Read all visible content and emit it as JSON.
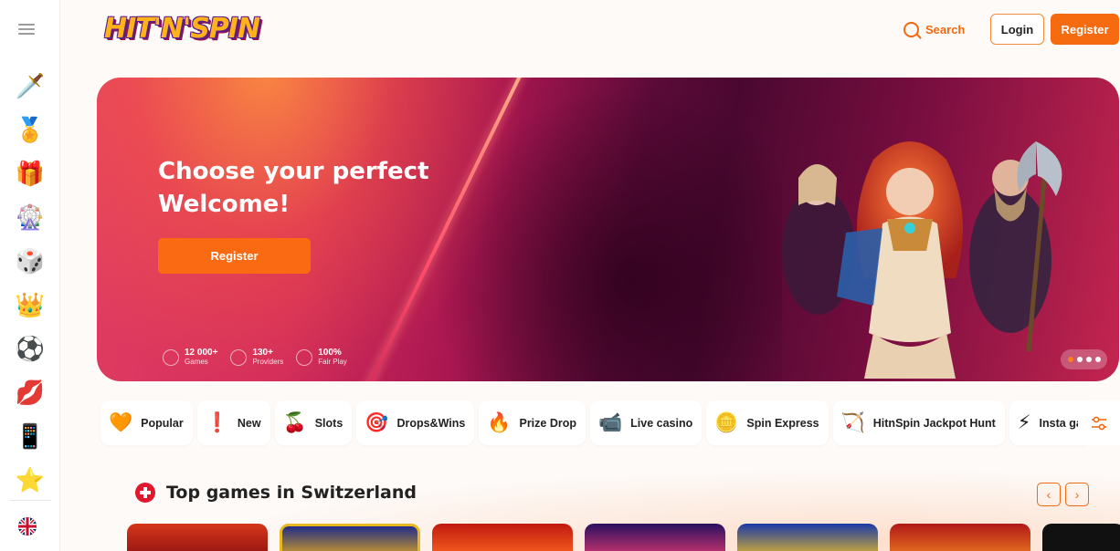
{
  "header": {
    "logo_text": "HIT'N'SPIN",
    "search_label": "Search",
    "login_label": "Login",
    "register_label": "Register"
  },
  "sidebar": {
    "items": [
      {
        "icon": "sword-icon",
        "glyph": "🗡️"
      },
      {
        "icon": "medal-icon",
        "glyph": "🏅"
      },
      {
        "icon": "gift-icon",
        "glyph": "🎁"
      },
      {
        "icon": "wheel-icon",
        "glyph": "🎡"
      },
      {
        "icon": "dice-icon",
        "glyph": "🎲"
      },
      {
        "icon": "crown-icon",
        "glyph": "👑"
      },
      {
        "icon": "football-icon",
        "glyph": "⚽"
      },
      {
        "icon": "lips-icon",
        "glyph": "💋"
      },
      {
        "icon": "phone-icon",
        "glyph": "📱"
      },
      {
        "icon": "star-icon",
        "glyph": "⭐"
      }
    ],
    "language_icon": "uk-flag-icon"
  },
  "banner": {
    "title": "Choose your perfect Welcome!",
    "register_label": "Register",
    "stats": [
      {
        "value": "12 000+",
        "label": "Games"
      },
      {
        "value": "130+",
        "label": "Providers"
      },
      {
        "value": "100%",
        "label": "Fair Play"
      }
    ]
  },
  "categories": [
    {
      "label": "Popular",
      "icon": "heart-icon",
      "glyph": "🧡"
    },
    {
      "label": "New",
      "icon": "new-icon",
      "glyph": "❗"
    },
    {
      "label": "Slots",
      "icon": "cherry-icon",
      "glyph": "🍒"
    },
    {
      "label": "Drops&Wins",
      "icon": "drops-wins-icon",
      "glyph": "🎯"
    },
    {
      "label": "Prize Drop",
      "icon": "flame-icon",
      "glyph": "🔥"
    },
    {
      "label": "Live casino",
      "icon": "camera-icon",
      "glyph": "📹"
    },
    {
      "label": "Spin Express",
      "icon": "g-coin-icon",
      "glyph": "🪙"
    },
    {
      "label": "HitnSpin Jackpot Hunt",
      "icon": "hunter-icon",
      "glyph": "🏹"
    },
    {
      "label": "Insta ga",
      "icon": "lightning-icon",
      "glyph": "⚡"
    }
  ],
  "top_games": {
    "title": "Top games in Switzerland",
    "prev_label": "‹",
    "next_label": "›"
  },
  "colors": {
    "accent": "#f76b10",
    "banner_pink": "#e23f62",
    "banner_dark": "#4a0830"
  }
}
